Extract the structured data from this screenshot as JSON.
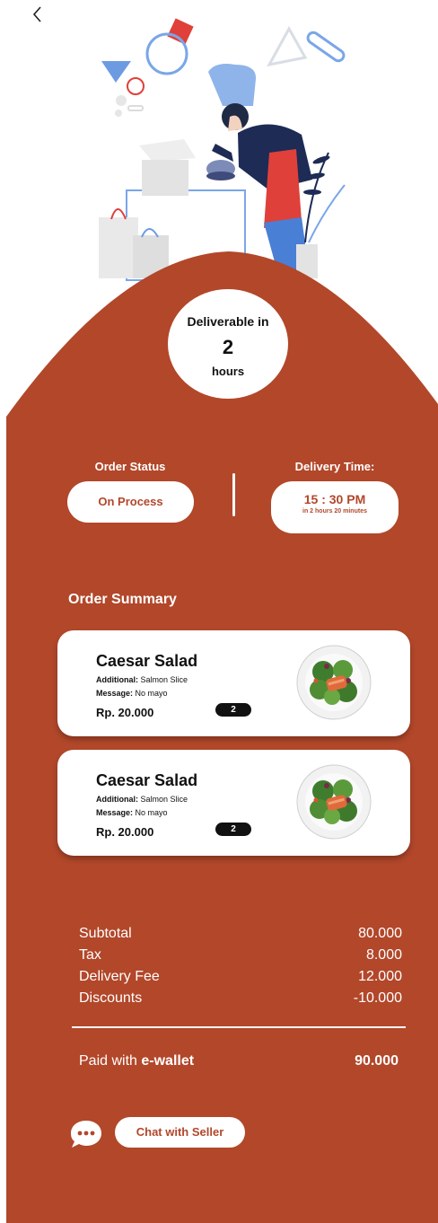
{
  "colors": {
    "accent": "#b2472a",
    "card": "#ffffff",
    "text": "#111111"
  },
  "header": {
    "back_icon": "chevron-left-icon"
  },
  "delivery": {
    "label": "Deliverable in",
    "value": "2",
    "unit": "hours"
  },
  "status": {
    "order_status_label": "Order Status",
    "order_status_value": "On Process",
    "delivery_time_label": "Delivery Time:",
    "delivery_time_value": "15 : 30 PM",
    "delivery_time_sub": "in 2 hours 20 minutes"
  },
  "summary": {
    "title": "Order Summary",
    "items": [
      {
        "name": "Caesar Salad",
        "additional_label": "Additional:",
        "additional_value": "Salmon Slice",
        "message_label": "Message:",
        "message_value": "No mayo",
        "price": "Rp. 20.000",
        "qty": "2"
      },
      {
        "name": "Caesar Salad",
        "additional_label": "Additional:",
        "additional_value": "Salmon Slice",
        "message_label": "Message:",
        "message_value": "No mayo",
        "price": "Rp. 20.000",
        "qty": "2"
      }
    ]
  },
  "totals": {
    "rows": [
      {
        "label": "Subtotal",
        "value": "80.000"
      },
      {
        "label": "Tax",
        "value": "8.000"
      },
      {
        "label": "Delivery Fee",
        "value": "12.000"
      },
      {
        "label": "Discounts",
        "value": "-10.000"
      }
    ],
    "paid_prefix": "Paid with ",
    "paid_method": "e-wallet",
    "paid_amount": "90.000"
  },
  "chat": {
    "icon": "chat-bubble-icon",
    "button_label": "Chat with Seller"
  }
}
